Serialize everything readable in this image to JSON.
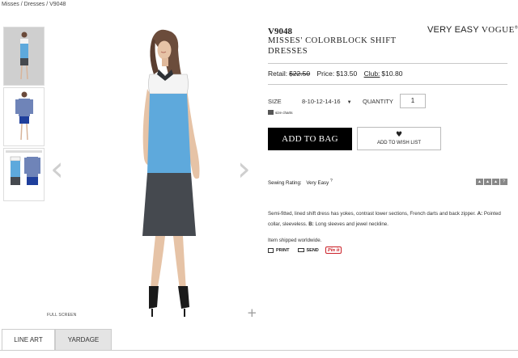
{
  "breadcrumb": "Misses / Dresses / V9048",
  "gallery": {
    "thumbnails": [
      "thumb-1",
      "thumb-2",
      "thumb-3"
    ],
    "prev_icon": "‹",
    "next_icon": "›",
    "fullscreen_label": "FULL SCREEN",
    "zoom_icon": "+"
  },
  "tabs": [
    {
      "label": "LINE ART"
    },
    {
      "label": "YARDAGE"
    }
  ],
  "product": {
    "sku": "V9048",
    "title": "MISSES' COLORBLOCK SHIFT DRESSES",
    "brand_left": "VERY EASY ",
    "brand_right": "VOGUE",
    "brand_reg": "®"
  },
  "pricing": {
    "retail_label": "Retail:",
    "retail_value": "$22.50",
    "price_label": "Price:",
    "price_value": "$13.50",
    "club_label": "Club:",
    "club_value": "$10.80"
  },
  "options": {
    "size_label": "SIZE",
    "size_value": "8-10-12-14-16",
    "size_caret": "▼",
    "size_charts": "size charts",
    "quantity_label": "QUANTITY",
    "quantity_value": "1"
  },
  "actions": {
    "add_to_bag": "ADD TO BAG",
    "wish_icon": "♥",
    "add_to_wish": "ADD TO WISH LIST"
  },
  "rating": {
    "label": "Sewing Rating:",
    "value": "Very Easy",
    "help": "?",
    "boxes": [
      "▲",
      "▲",
      "▲",
      "?"
    ]
  },
  "description": {
    "text_part1": "Semi-fitted, lined shift dress has yokes, contrast lower sections, French darts and back zipper. ",
    "a_label": "A:",
    "text_part2": " Pointed collar, sleeveless. ",
    "b_label": "B:",
    "text_part3": " Long sleeves and jewel neckline.",
    "shipping": "Item shipped worldwide."
  },
  "share": {
    "print": "PRINT",
    "send": "SEND",
    "pin": "Pin it"
  },
  "colors": {
    "dress_blue": "#5ea9dc",
    "dress_charcoal": "#45494f",
    "yoke_white": "#f4f4f4",
    "pin_red": "#cb2027"
  }
}
